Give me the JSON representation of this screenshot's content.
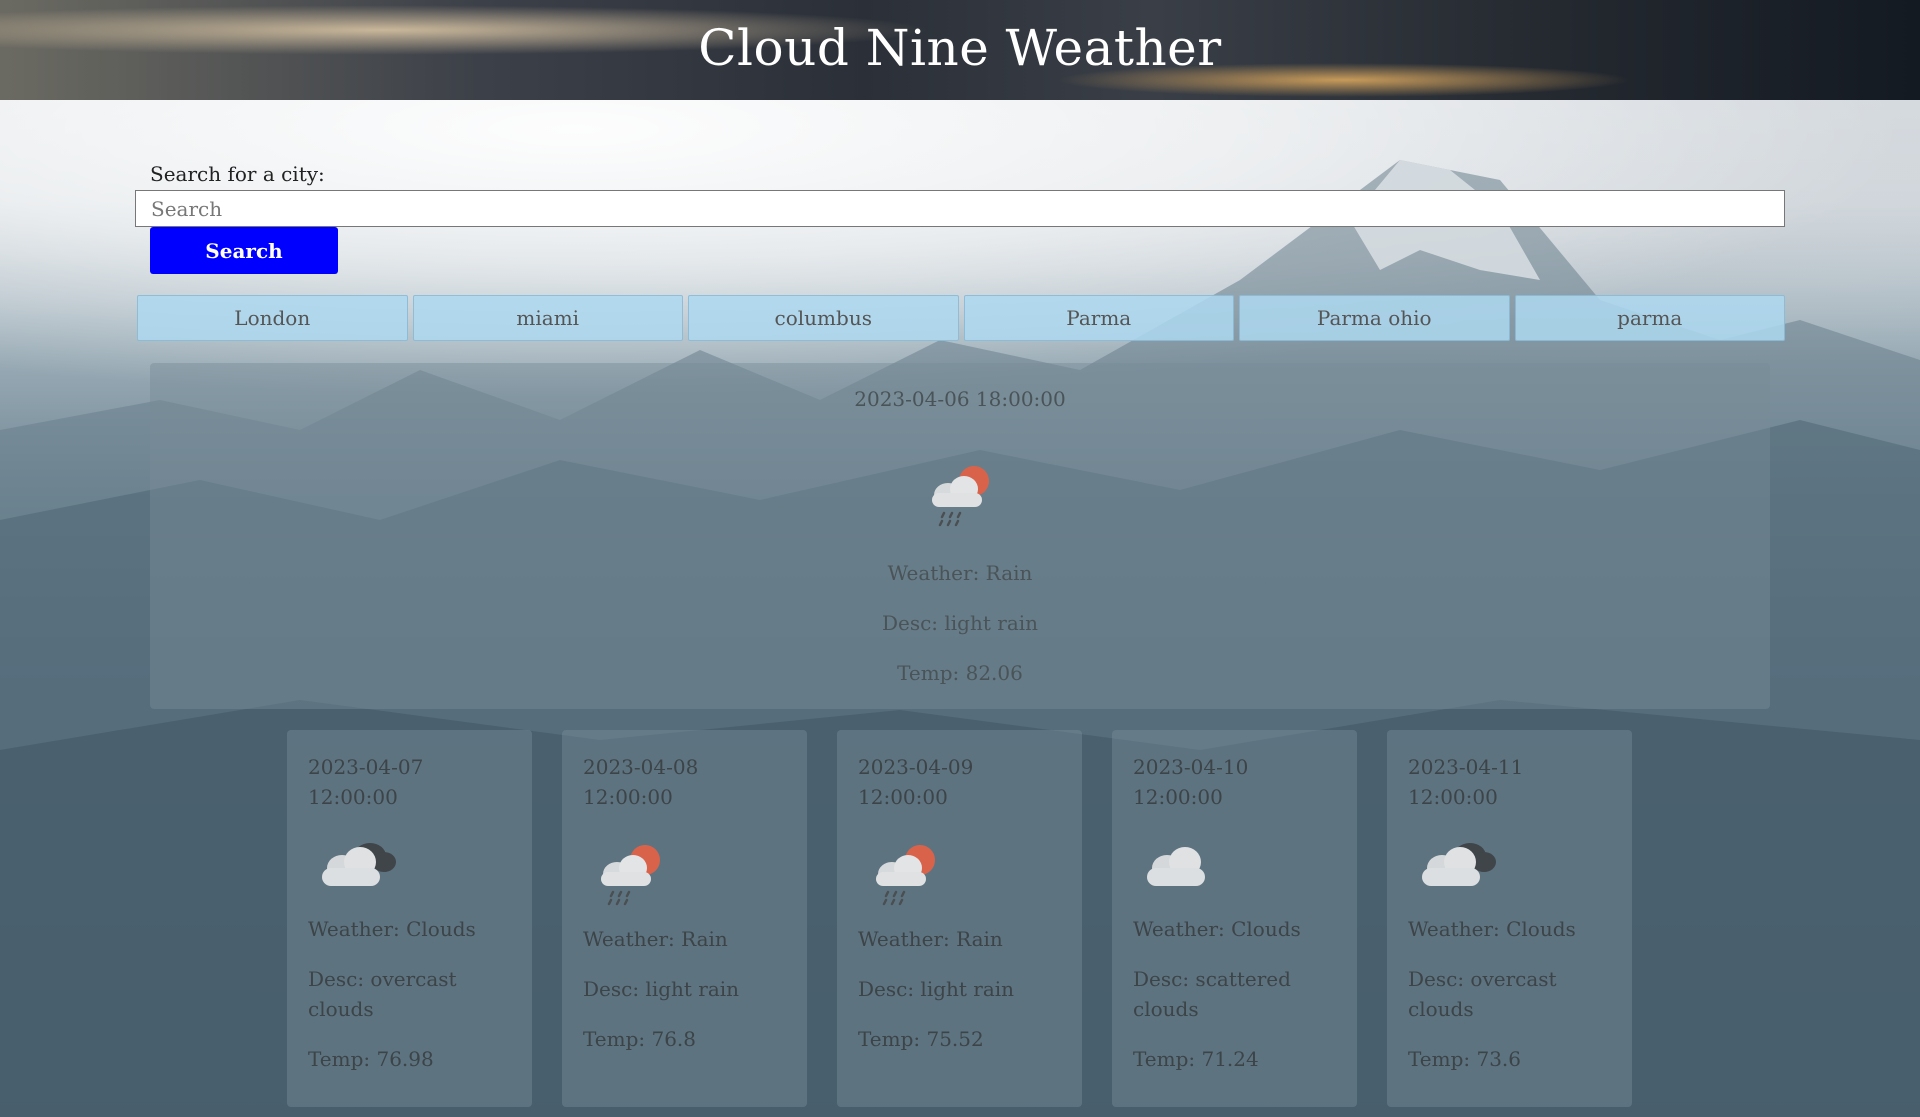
{
  "header": {
    "title": "Cloud Nine Weather"
  },
  "search": {
    "label": "Search for a city:",
    "placeholder": "Search",
    "value": "",
    "button_label": "Search"
  },
  "history": [
    "London",
    "miami",
    "columbus",
    "Parma",
    "Parma ohio",
    "parma"
  ],
  "current": {
    "date": "2023-04-06 18:00:00",
    "icon": "rain-sun-icon",
    "weather": "Weather: Rain",
    "desc": "Desc: light rain",
    "temp": "Temp: 82.06"
  },
  "forecast": [
    {
      "date": "2023-04-07 12:00:00",
      "icon": "overcast-clouds-icon",
      "weather": "Weather: Clouds",
      "desc": "Desc: overcast clouds",
      "temp": "Temp: 76.98"
    },
    {
      "date": "2023-04-08 12:00:00",
      "icon": "rain-sun-icon",
      "weather": "Weather: Rain",
      "desc": "Desc: light rain",
      "temp": "Temp: 76.8"
    },
    {
      "date": "2023-04-09 12:00:00",
      "icon": "rain-sun-icon",
      "weather": "Weather: Rain",
      "desc": "Desc: light rain",
      "temp": "Temp: 75.52"
    },
    {
      "date": "2023-04-10 12:00:00",
      "icon": "cloud-icon",
      "weather": "Weather: Clouds",
      "desc": "Desc: scattered clouds",
      "temp": "Temp: 71.24"
    },
    {
      "date": "2023-04-11 12:00:00",
      "icon": "overcast-clouds-icon",
      "weather": "Weather: Clouds",
      "desc": "Desc: overcast clouds",
      "temp": "Temp: 73.6"
    }
  ],
  "colors": {
    "search_button": "#0000ff",
    "history_button": "#add8f0"
  }
}
